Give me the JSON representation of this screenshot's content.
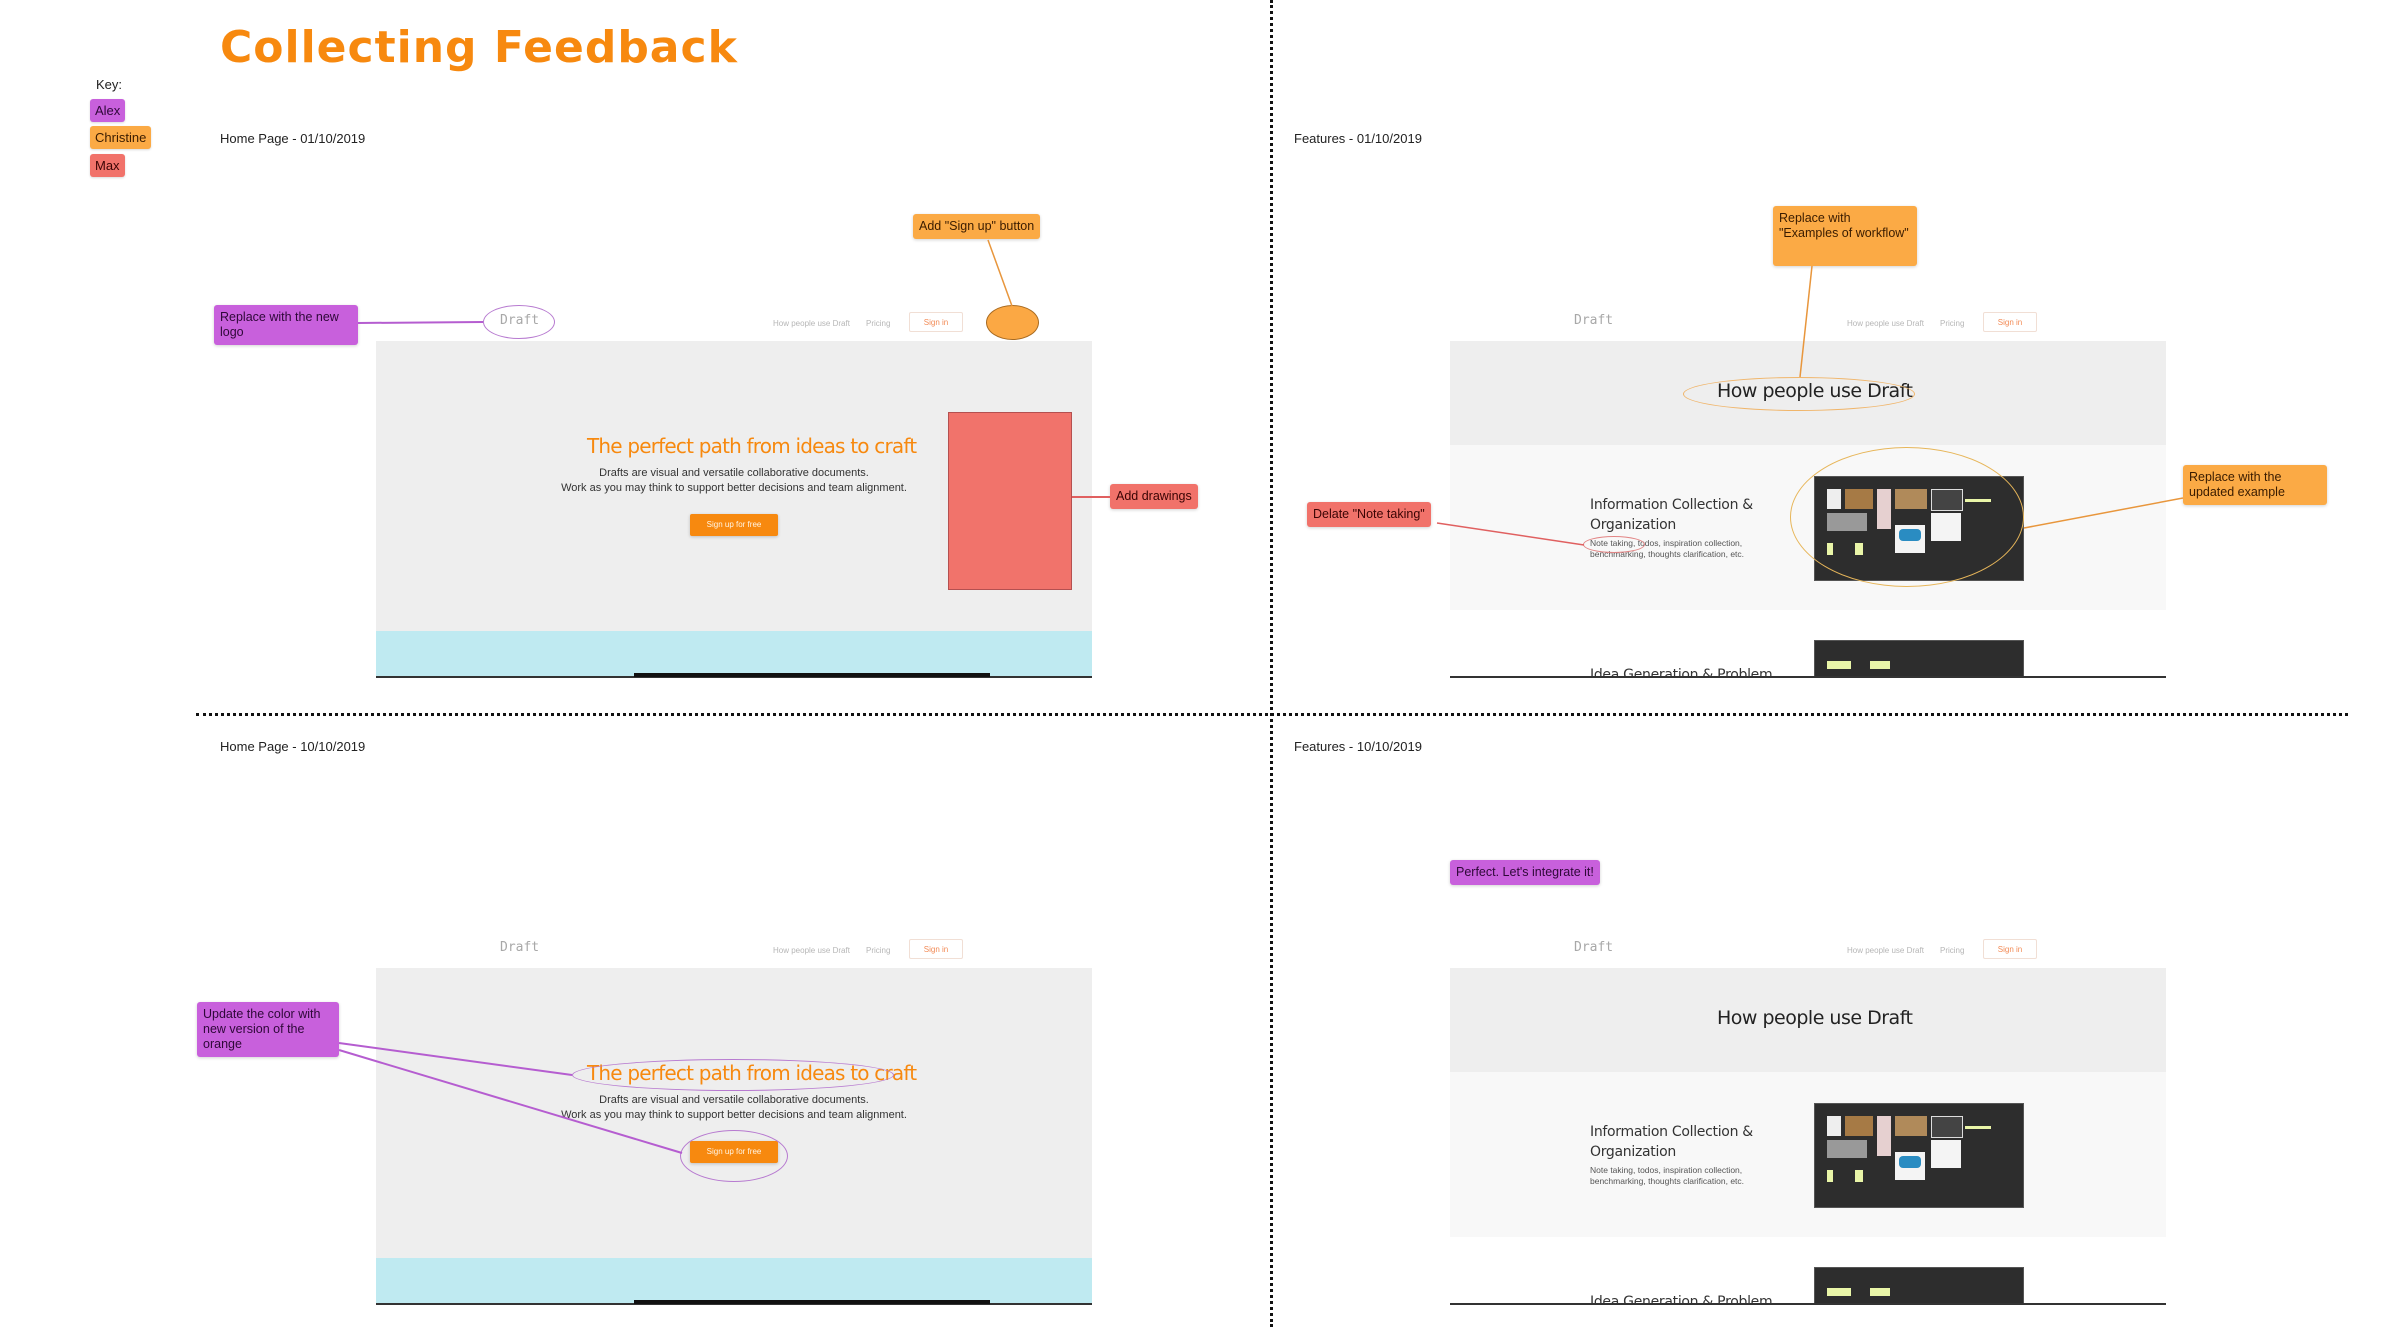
{
  "board": {
    "title": "Collecting Feedback",
    "key": {
      "label": "Key:",
      "reviewers": [
        {
          "name": "Alex",
          "color": "#c860dc"
        },
        {
          "name": "Christine",
          "color": "#fbaa45"
        },
        {
          "name": "Max",
          "color": "#f1726a"
        }
      ]
    }
  },
  "frames": {
    "home_v1": {
      "label": "Home Page - 01/10/2019",
      "nav": {
        "logo": "Draft",
        "links": [
          "How people use Draft",
          "Pricing"
        ],
        "signin": "Sign in"
      },
      "hero": {
        "headline": "The perfect path from ideas to craft",
        "subline1": "Drafts are visual and versatile collaborative documents.",
        "subline2": "Work as you may think to support better decisions and team alignment.",
        "cta": "Sign up for free"
      },
      "comments": [
        {
          "author": "Alex",
          "text": "Replace with the new logo"
        },
        {
          "author": "Christine",
          "text": "Add \"Sign up\" button"
        },
        {
          "author": "Max",
          "text": "Add drawings"
        }
      ]
    },
    "features_v1": {
      "label": "Features - 01/10/2019",
      "nav": {
        "logo": "Draft",
        "links": [
          "How people use Draft",
          "Pricing"
        ],
        "signin": "Sign in"
      },
      "heading": "How people use Draft",
      "section1": {
        "title_line1": "Information Collection &",
        "title_line2": "Organization",
        "desc_line1": "Note taking, todos, inspiration collection,",
        "desc_line2": "benchmarking, thoughts clarification, etc."
      },
      "section2": {
        "title": "Idea Generation & Problem"
      },
      "comments": [
        {
          "author": "Christine",
          "text": "Replace with \"Examples of workflow\""
        },
        {
          "author": "Max",
          "text": "Delate \"Note taking\""
        },
        {
          "author": "Christine",
          "text": "Replace with the updated example"
        }
      ]
    },
    "home_v2": {
      "label": "Home Page - 10/10/2019",
      "nav": {
        "logo": "Draft",
        "links": [
          "How people use Draft",
          "Pricing"
        ],
        "signin": "Sign in"
      },
      "hero": {
        "headline": "The perfect path from ideas to craft",
        "subline1": "Drafts are visual and versatile collaborative documents.",
        "subline2": "Work as you may think to support better decisions and team alignment.",
        "cta": "Sign up for free"
      },
      "comments": [
        {
          "author": "Alex",
          "text": "Update the color with new version of the orange"
        }
      ]
    },
    "features_v2": {
      "label": "Features - 10/10/2019",
      "nav": {
        "logo": "Draft",
        "links": [
          "How people use Draft",
          "Pricing"
        ],
        "signin": "Sign in"
      },
      "heading": "How people use Draft",
      "section1": {
        "title_line1": "Information Collection &",
        "title_line2": "Organization",
        "desc_line1": "Note taking, todos, inspiration collection,",
        "desc_line2": "benchmarking, thoughts clarification, etc."
      },
      "section2": {
        "title": "Idea Generation & Problem"
      },
      "comments": [
        {
          "author": "Alex",
          "text": "Perfect. Let's integrate it!"
        }
      ]
    }
  }
}
